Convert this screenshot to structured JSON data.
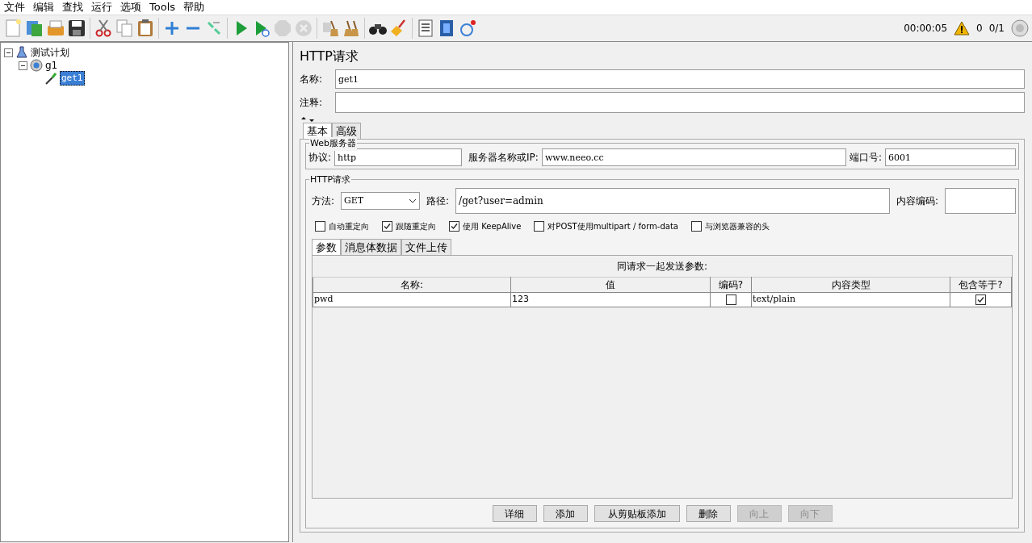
{
  "menu": [
    "文件",
    "编辑",
    "查找",
    "运行",
    "选项",
    "Tools",
    "帮助"
  ],
  "toolbar": [
    [
      {
        "disabled": false
      },
      {
        "disabled": false
      },
      {
        "disabled": false
      },
      {
        "disabled": false
      }
    ],
    [
      {
        "disabled": false
      },
      {
        "disabled": false
      },
      {
        "disabled": false
      }
    ],
    [
      {
        "disabled": false
      },
      {
        "disabled": false
      },
      {
        "disabled": false
      }
    ],
    [
      {
        "disabled": false
      },
      {
        "disabled": false
      },
      {
        "disabled": true
      },
      {
        "disabled": true
      }
    ],
    [
      {
        "disabled": false
      },
      {
        "disabled": false
      }
    ],
    [
      {
        "disabled": false
      },
      {
        "disabled": false
      }
    ],
    [
      {
        "disabled": false
      },
      {
        "disabled": false
      },
      {
        "disabled": false
      }
    ]
  ],
  "status": {
    "timer": "00:00:05",
    "warnings": "0",
    "threads": "0/1"
  },
  "tree": [
    {
      "label": "测试计划",
      "kind": "plan",
      "expanded": true,
      "selected": false,
      "children": [
        {
          "label": "g1",
          "kind": "group",
          "expanded": true,
          "selected": false,
          "children": [
            {
              "label": "get1",
              "kind": "sampler",
              "selected": true
            }
          ]
        }
      ]
    }
  ],
  "editor": {
    "title": "HTTP请求",
    "name_label": "名称:",
    "name": "get1",
    "comment_label": "注释:",
    "tabs": [
      {
        "label": "基本",
        "selected": true
      },
      {
        "label": "高级",
        "selected": false
      }
    ],
    "web_server": {
      "legend": "Web服务器",
      "protocol_label": "协议:",
      "protocol": "http",
      "server_label": "服务器名称或IP:",
      "server": "www.neeo.cc",
      "port_label": "端口号:",
      "port": "6001"
    },
    "http_request": {
      "legend": "HTTP请求",
      "method_label": "方法:",
      "method": "GET",
      "path_label": "路径:",
      "path": "/get?user=admin",
      "encoding_label": "内容编码:",
      "options": [
        {
          "label": "自动重定向",
          "checked": false
        },
        {
          "label": "跟随重定向",
          "checked": true
        },
        {
          "label": "使用 KeepAlive",
          "checked": true
        },
        {
          "label": "对POST使用multipart / form-data",
          "checked": false
        },
        {
          "label": "与浏览器兼容的头",
          "checked": false
        }
      ],
      "tabs": [
        {
          "label": "参数",
          "selected": true
        },
        {
          "label": "消息体数据",
          "selected": false
        },
        {
          "label": "文件上传",
          "selected": false
        }
      ],
      "params": {
        "caption": "同请求一起发送参数:",
        "columns": [
          "名称:",
          "值",
          "编码?",
          "内容类型",
          "包含等于?"
        ],
        "rows": [
          {
            "name": "pwd",
            "value": "123",
            "encode": false,
            "content_type": "text/plain",
            "include_equals": true
          }
        ]
      },
      "buttons": [
        {
          "label": "详细",
          "disabled": false
        },
        {
          "label": "添加",
          "disabled": false
        },
        {
          "label": "从剪贴板添加",
          "disabled": false
        },
        {
          "label": "删除",
          "disabled": false
        },
        {
          "label": "向上",
          "disabled": true
        },
        {
          "label": "向下",
          "disabled": true
        }
      ]
    }
  }
}
